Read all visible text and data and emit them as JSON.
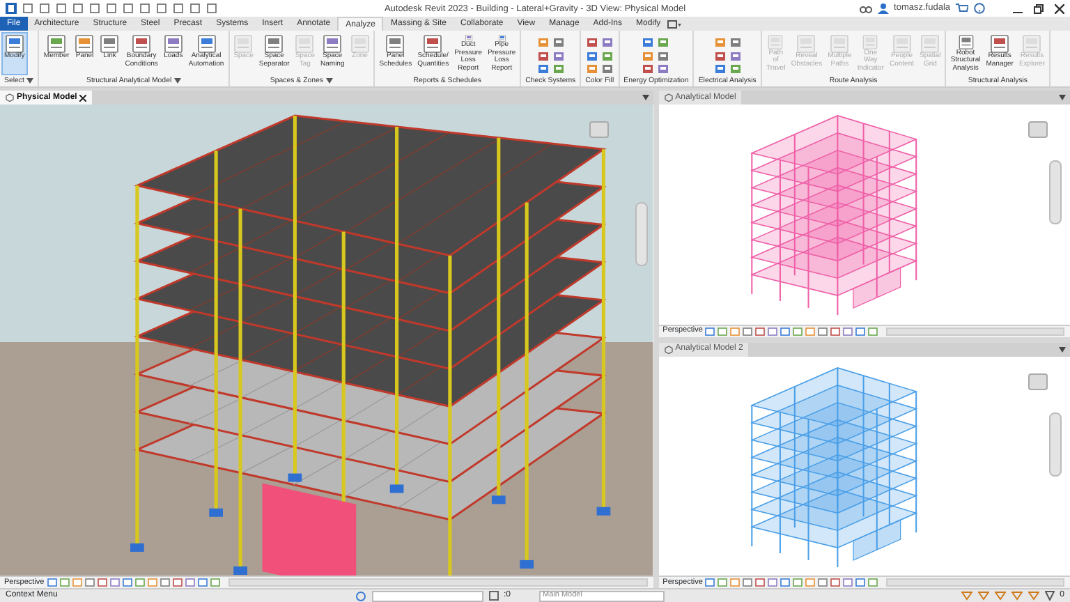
{
  "window": {
    "title": "Autodesk Revit 2023 - Building - Lateral+Gravity - 3D View: Physical Model",
    "user": "tomasz.fudala"
  },
  "tabs": [
    {
      "label": "File",
      "kind": "file",
      "selected": false
    },
    {
      "label": "Architecture",
      "kind": "tab",
      "selected": false
    },
    {
      "label": "Structure",
      "kind": "tab",
      "selected": false
    },
    {
      "label": "Steel",
      "kind": "tab",
      "selected": false
    },
    {
      "label": "Precast",
      "kind": "tab",
      "selected": false
    },
    {
      "label": "Systems",
      "kind": "tab",
      "selected": false
    },
    {
      "label": "Insert",
      "kind": "tab",
      "selected": false
    },
    {
      "label": "Annotate",
      "kind": "tab",
      "selected": false
    },
    {
      "label": "Analyze",
      "kind": "tab",
      "selected": true
    },
    {
      "label": "Massing & Site",
      "kind": "tab",
      "selected": false
    },
    {
      "label": "Collaborate",
      "kind": "tab",
      "selected": false
    },
    {
      "label": "View",
      "kind": "tab",
      "selected": false
    },
    {
      "label": "Manage",
      "kind": "tab",
      "selected": false
    },
    {
      "label": "Add-Ins",
      "kind": "tab",
      "selected": false
    },
    {
      "label": "Modify",
      "kind": "tab",
      "selected": false
    }
  ],
  "panels": [
    {
      "title": "Select",
      "kind": "large",
      "title_menu": true,
      "buttons": [
        {
          "label": "Modify",
          "selected": true,
          "disabled": false
        }
      ]
    },
    {
      "title": "Structural Analytical Model",
      "kind": "large",
      "title_menu": true,
      "buttons": [
        {
          "label": "Member",
          "selected": false,
          "disabled": false
        },
        {
          "label": "Panel",
          "selected": false,
          "disabled": false
        },
        {
          "label": "Link",
          "selected": false,
          "disabled": false
        },
        {
          "label": "Boundary Conditions",
          "selected": false,
          "disabled": false
        },
        {
          "label": "Loads",
          "selected": false,
          "disabled": false
        },
        {
          "label": "Analytical Automation",
          "selected": false,
          "disabled": false
        }
      ]
    },
    {
      "title": "Spaces & Zones",
      "kind": "large",
      "title_menu": true,
      "buttons": [
        {
          "label": "Space",
          "selected": false,
          "disabled": true
        },
        {
          "label": "Space Separator",
          "selected": false,
          "disabled": false
        },
        {
          "label": "Space Tag",
          "selected": false,
          "disabled": true
        },
        {
          "label": "Space Naming",
          "selected": false,
          "disabled": false
        },
        {
          "label": "Zone",
          "selected": false,
          "disabled": true
        }
      ]
    },
    {
      "title": "Reports & Schedules",
      "kind": "large",
      "title_menu": false,
      "buttons": [
        {
          "label": "Panel Schedules",
          "selected": false,
          "disabled": false
        },
        {
          "label": "Schedule/ Quantities",
          "selected": false,
          "disabled": false
        },
        {
          "label": "Duct Pressure Loss Report",
          "selected": false,
          "disabled": false
        },
        {
          "label": "Pipe Pressure Loss Report",
          "selected": false,
          "disabled": false
        }
      ]
    },
    {
      "title": "Check Systems",
      "kind": "compact",
      "title_menu": false
    },
    {
      "title": "Color Fill",
      "kind": "compact",
      "title_menu": false
    },
    {
      "title": "Energy Optimization",
      "kind": "compact",
      "title_menu": false
    },
    {
      "title": "Electrical Analysis",
      "kind": "compact",
      "title_menu": false
    },
    {
      "title": "Route Analysis",
      "kind": "large",
      "title_menu": false,
      "buttons": [
        {
          "label": "Path of Travel",
          "selected": false,
          "disabled": true
        },
        {
          "label": "Reveal Obstacles",
          "selected": false,
          "disabled": true
        },
        {
          "label": "Multiple Paths",
          "selected": false,
          "disabled": true
        },
        {
          "label": "One Way Indicator",
          "selected": false,
          "disabled": true
        },
        {
          "label": "People Content",
          "selected": false,
          "disabled": true
        },
        {
          "label": "Spatial Grid",
          "selected": false,
          "disabled": true
        }
      ]
    },
    {
      "title": "Structural Analysis",
      "kind": "large",
      "title_menu": false,
      "buttons": [
        {
          "label": "Robot Structural Analysis",
          "selected": false,
          "disabled": false
        },
        {
          "label": "Results Manager",
          "selected": false,
          "disabled": false
        },
        {
          "label": "Results Explorer",
          "selected": false,
          "disabled": true
        }
      ]
    }
  ],
  "views": [
    {
      "title": "Physical Model",
      "kind": "physical",
      "active": true,
      "footer": "Perspective"
    },
    {
      "title": "Analytical Model",
      "kind": "analytical",
      "active": false,
      "color": "#ef5fa7",
      "footer": "Perspective"
    },
    {
      "title": "Analytical Model 2",
      "kind": "analytical",
      "active": false,
      "color": "#4a9fe8",
      "footer": "Perspective"
    }
  ],
  "status_bar": {
    "message": "Context Menu",
    "selection_count": ":0",
    "model": "Main Model",
    "filter_count": "0"
  }
}
